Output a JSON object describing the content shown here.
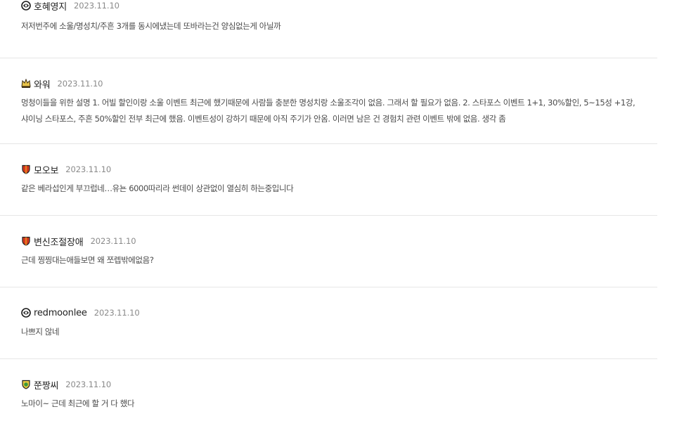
{
  "comments": [
    {
      "badge_icon": "guild-emblem-bw-icon",
      "nickname": "호혜영지",
      "date": "2023.11.10",
      "text": "저저번주에 소울/명성치/주흔 3개를 동시에냈는데 또바라는건 양심없는게 아닐까"
    },
    {
      "badge_icon": "crown-emblem-icon",
      "nickname": "와워",
      "date": "2023.11.10",
      "text": "멍청이들을 위한 설명 1. 어빌 할인이랑 소울 이벤트 최근에 했기때문에 사람들 충분한 명성치랑 소울조각이 없음. 그래서 할 필요가 없음. 2. 스타포스 이벤트 1+1, 30%할인, 5~15성 +1강, 샤이닝 스타포스, 주흔 50%할인 전부 최근에 했음. 이벤트성이 강하기 때문에 아직 주기가 안옴. 이러면 남은 건 경험치 관련 이벤트 밖에 없음. 생각 좀"
    },
    {
      "badge_icon": "red-shield-icon",
      "nickname": "모오보",
      "date": "2023.11.10",
      "text": "같은 베라섭인게 부끄럽네…유뇬 6000따리라 썬데이 상관없이 열심히 하는중입니다"
    },
    {
      "badge_icon": "red-shield-icon",
      "nickname": "변신조절장애",
      "date": "2023.11.10",
      "text": "근데 찡찡대는애들보면 왜 쪼렙밖에없음?"
    },
    {
      "badge_icon": "guild-emblem-bw-icon",
      "nickname": "redmoonlee",
      "date": "2023.11.10",
      "text": "나쁘지 않네"
    },
    {
      "badge_icon": "green-shield-icon",
      "nickname": "쭌짱씨",
      "date": "2023.11.10",
      "text": "노마이~ 근데 최근에 할 거 다 했다"
    }
  ]
}
